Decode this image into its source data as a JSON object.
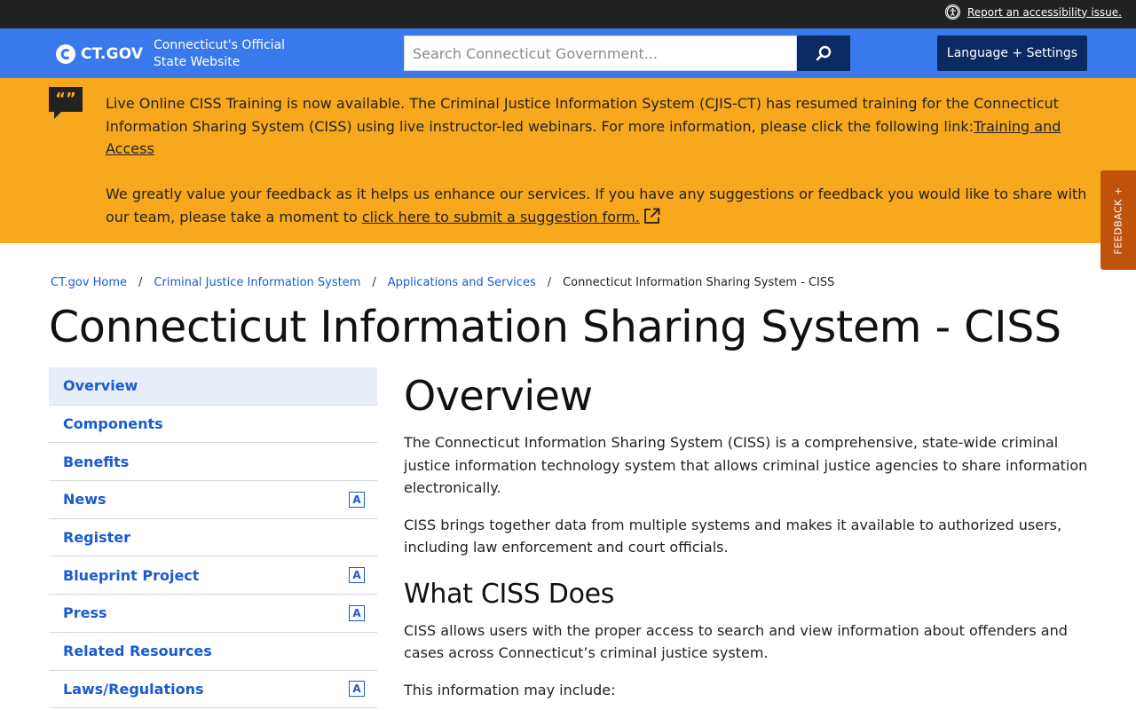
{
  "topbar": {
    "accessibility_link": "Report an accessibility issue."
  },
  "header": {
    "logo_text": "CT.GOV",
    "tagline": "Connecticut's Official State Website",
    "search_placeholder": "Search Connecticut Government...",
    "language_button": "Language + Settings"
  },
  "alert": {
    "para1_text": "Live Online CISS Training is now available. The Criminal Justice Information System (CJIS-CT) has resumed training for the Connecticut Information Sharing System (CISS) using live instructor-led webinars. For more information, please click the following link:",
    "para1_link": "Training and Access",
    "para2_text": "We greatly value your feedback as it helps us enhance our services. If you have any suggestions or feedback you would like to share with our team, please take a moment to ",
    "para2_link": "click here to submit a suggestion form."
  },
  "feedback_tab": "FEEDBACK +",
  "breadcrumb": {
    "items": [
      "CT.gov Home",
      "Criminal Justice Information System",
      "Applications and Services"
    ],
    "current": "Connecticut Information Sharing System - CISS"
  },
  "page_title": "Connecticut Information Sharing System - CISS",
  "sidenav": {
    "items": [
      {
        "label": "Overview",
        "external": false
      },
      {
        "label": "Components",
        "external": false
      },
      {
        "label": "Benefits",
        "external": false
      },
      {
        "label": "News",
        "external": true
      },
      {
        "label": "Register",
        "external": false
      },
      {
        "label": "Blueprint Project",
        "external": true
      },
      {
        "label": "Press",
        "external": true
      },
      {
        "label": "Related Resources",
        "external": false
      },
      {
        "label": "Laws/Regulations",
        "external": true
      }
    ],
    "external_badge": "A"
  },
  "main": {
    "heading": "Overview",
    "p1": "The Connecticut Information Sharing System (CISS) is a comprehensive, state-wide criminal justice information technology system that allows criminal justice agencies to share information electronically.",
    "p2": "CISS brings together data from multiple systems and makes it available to authorized users, including law enforcement and court officials.",
    "subheading": "What CISS Does",
    "p3": "CISS allows users with the proper access to search and view information about offenders and cases across Connecticut’s criminal justice system.",
    "p4": "This information may include:"
  }
}
